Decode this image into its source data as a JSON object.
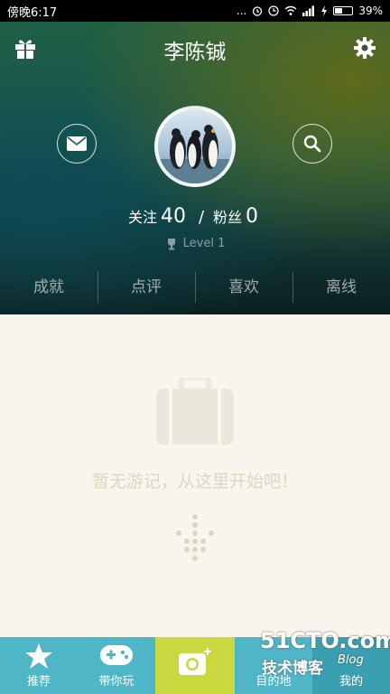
{
  "status_bar": {
    "time": "傍晚6:17",
    "dots": "...",
    "battery": "39%"
  },
  "header": {
    "title": "李陈铖"
  },
  "stats": {
    "follow_label": "关注",
    "follow_count": "40",
    "separator": "/",
    "fans_label": "粉丝",
    "fans_count": "0"
  },
  "level": {
    "text": "Level 1"
  },
  "tabs": [
    {
      "label": "成就"
    },
    {
      "label": "点评"
    },
    {
      "label": "喜欢"
    },
    {
      "label": "离线"
    }
  ],
  "empty_state": {
    "message": "暂无游记，从这里开始吧！"
  },
  "bottom_nav": {
    "items": [
      {
        "label": "推荐"
      },
      {
        "label": "带你玩"
      },
      {
        "label": ""
      },
      {
        "label": "目的地"
      },
      {
        "label": "我的"
      }
    ]
  },
  "watermark": {
    "line1": "51CTO.com",
    "line2": "技术博客",
    "line3": "Blog"
  },
  "colors": {
    "nav_bg": "#4fb6c8",
    "camera_bg": "#cbd73f",
    "nav_active": "#3a9fb1",
    "content_bg": "#f8f5ec"
  }
}
